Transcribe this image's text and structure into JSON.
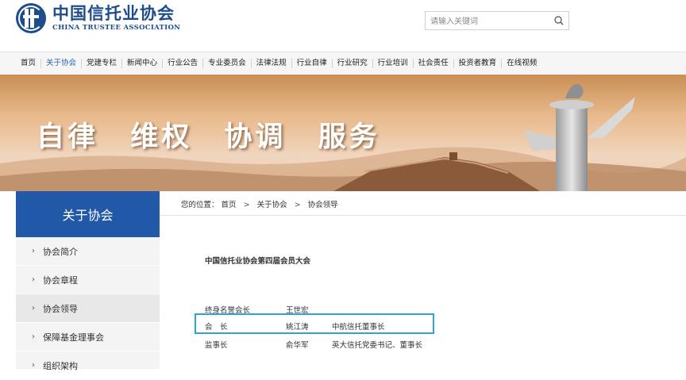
{
  "header": {
    "logo_cn": "中国信托业协会",
    "logo_en": "CHINA TRUSTEE ASSOCIATION",
    "search_placeholder": "请输入关键词"
  },
  "nav": {
    "items": [
      "首页",
      "关于协会",
      "党建专栏",
      "新闻中心",
      "行业公告",
      "专业委员会",
      "法律法规",
      "行业自律",
      "行业研究",
      "行业培训",
      "社会责任",
      "投资者教育",
      "在线视频"
    ],
    "active_index": 1
  },
  "banner": {
    "slogan": [
      "自律",
      "维权",
      "协调",
      "服务"
    ]
  },
  "sidebar": {
    "title": "关于协会",
    "items": [
      {
        "label": "协会简介"
      },
      {
        "label": "协会章程"
      },
      {
        "label": "协会领导"
      },
      {
        "label": "保障基金理事会"
      },
      {
        "label": "组织架构"
      }
    ],
    "active_index": 2
  },
  "breadcrumb": {
    "prefix": "您的位置：",
    "items": [
      "首页",
      "关于协会",
      "协会领导"
    ],
    "separator": ">"
  },
  "content": {
    "title": "中国信托业协会第四届会员大会",
    "rows": [
      {
        "role": "终身名誉会长",
        "name": "王世宏",
        "org": ""
      },
      {
        "role": "会　长",
        "name": "姚江涛",
        "org": "中航信托董事长"
      },
      {
        "role": "监事长",
        "name": "俞华军",
        "org": "英大信托党委书记、董事长"
      }
    ]
  },
  "colors": {
    "brand": "#1e4d8c",
    "sidebar_title_bg": "#2159a8",
    "highlight_border": "#2aa7d6",
    "nav_active": "#2c63b5"
  }
}
